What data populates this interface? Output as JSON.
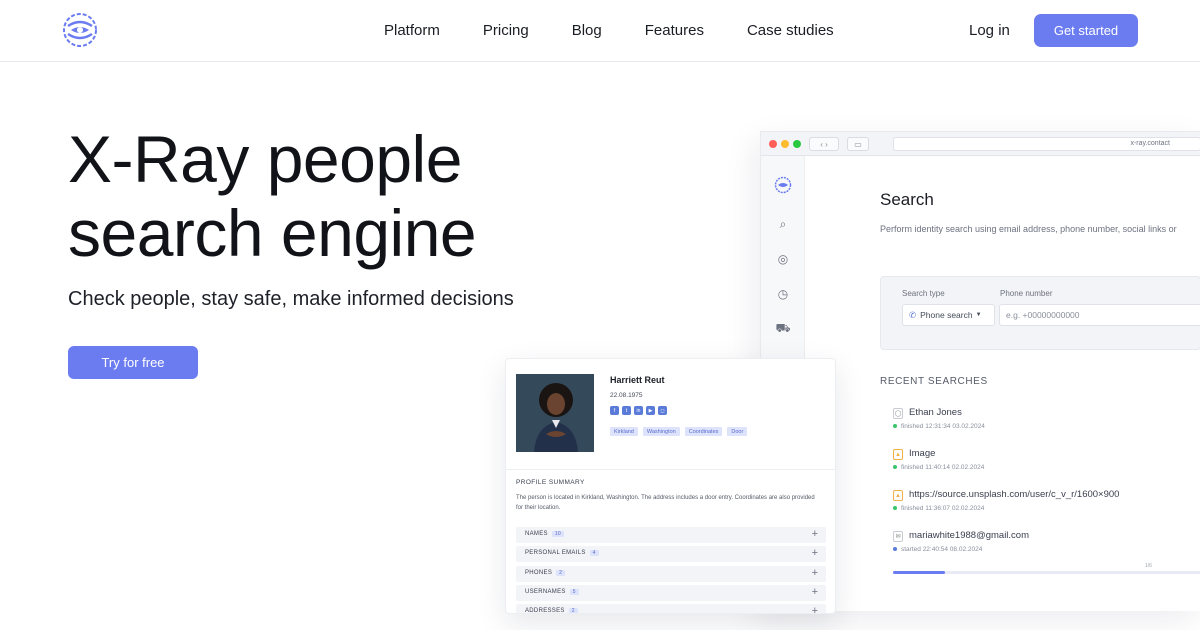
{
  "nav": {
    "links": [
      "Platform",
      "Pricing",
      "Blog",
      "Features",
      "Case studies"
    ],
    "login": "Log in",
    "cta": "Get started"
  },
  "hero": {
    "title_line1": "X-Ray people",
    "title_line2": "search engine",
    "subtitle": "Check people, stay safe, make informed decisions",
    "cta": "Try for free"
  },
  "browser": {
    "url": "x-ray.contact",
    "search_title": "Search",
    "search_desc": "Perform identity search using email address, phone number, social links or",
    "search_type_label": "Search type",
    "search_type_value": "Phone search",
    "phone_label": "Phone number",
    "phone_placeholder": "e.g. +00000000000",
    "recent_title": "RECENT SEARCHES",
    "recent": [
      {
        "name": "Ethan Jones",
        "status": "finished",
        "time": "12:31:34 03.02.2024",
        "icon": "person-icon",
        "status_color": "#3cc46a"
      },
      {
        "name": "Image",
        "status": "finished",
        "time": "11:40:14 02.02.2024",
        "icon": "image-icon",
        "status_color": "#3cc46a"
      },
      {
        "name": "https://source.unsplash.com/user/c_v_r/1600×900",
        "status": "finished",
        "time": "11:36:07 02.02.2024",
        "icon": "image-icon",
        "status_color": "#3cc46a"
      },
      {
        "name": "mariawhite1988@gmail.com",
        "status": "started",
        "time": "22:40:54 08.02.2024",
        "icon": "mail-icon",
        "status_color": "#5a7bd8"
      }
    ],
    "progress_fraction": 0.17,
    "progress_label": "1/6"
  },
  "profile": {
    "name": "Harriett Reut",
    "dob": "22.08.1975",
    "social_icons": [
      "facebook-icon",
      "twitter-icon",
      "linkedin-icon",
      "youtube-icon",
      "instagram-icon"
    ],
    "tags": [
      "Kirkland",
      "Washington",
      "Coordinates",
      "Door"
    ],
    "summary_title": "PROFILE SUMMARY",
    "summary_text": "The person is located in Kirkland, Washington. The address includes a door entry. Coordinates are also provided for their location.",
    "sections": [
      {
        "label": "NAMES",
        "count": "10"
      },
      {
        "label": "PERSONAL EMAILS",
        "count": "4"
      },
      {
        "label": "PHONES",
        "count": "2"
      },
      {
        "label": "USERNAMES",
        "count": "5"
      },
      {
        "label": "ADDRESSES",
        "count": "2"
      }
    ]
  },
  "colors": {
    "accent": "#6b7cf0",
    "text": "#111318"
  }
}
